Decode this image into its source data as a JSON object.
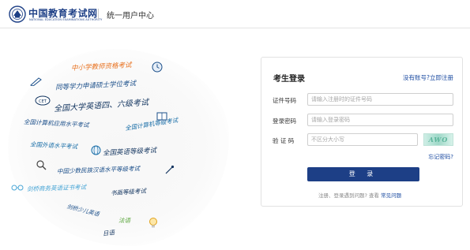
{
  "header": {
    "logo_cn": "中国教育考试网",
    "logo_en": "NATIONAL EDUCATION EXAMINATIONS AUTHORITY",
    "title": "统一用户中心"
  },
  "art": {
    "phrases": [
      "中小学教师资格考试",
      "同等学力申请硕士学位考试",
      "全国大学英语四、六级考试",
      "全国计算机应用水平考试",
      "全国计算机等级考试",
      "全国外语水平考试",
      "全国英语等级考试",
      "中国少数民族汉语水平等级考试",
      "剑桥商务英语证书考试",
      "书画等级考试",
      "剑桥少儿英语",
      "法语",
      "日语"
    ],
    "accent": "#1b6fa8",
    "highlight": "#e8711f",
    "green": "#5aa63c"
  },
  "login": {
    "title": "考生登录",
    "register_link": "没有账号?立即注册",
    "fields": {
      "id_label": "证件号码",
      "id_placeholder": "请输入注册时的证件号码",
      "password_label": "登录密码",
      "password_placeholder": "请输入登录密码",
      "captcha_label": "验 证 码",
      "captcha_placeholder": "不区分大小写"
    },
    "captcha_text": "AWO",
    "forgot_link": "忘记密码?",
    "login_button": "登 录",
    "help_text": "注册、登录遇到问题?  查看",
    "help_link": "常见问题"
  },
  "colors": {
    "brand": "#1d3f86",
    "link": "#1a4aa0",
    "captcha": "#9ed8c8"
  }
}
